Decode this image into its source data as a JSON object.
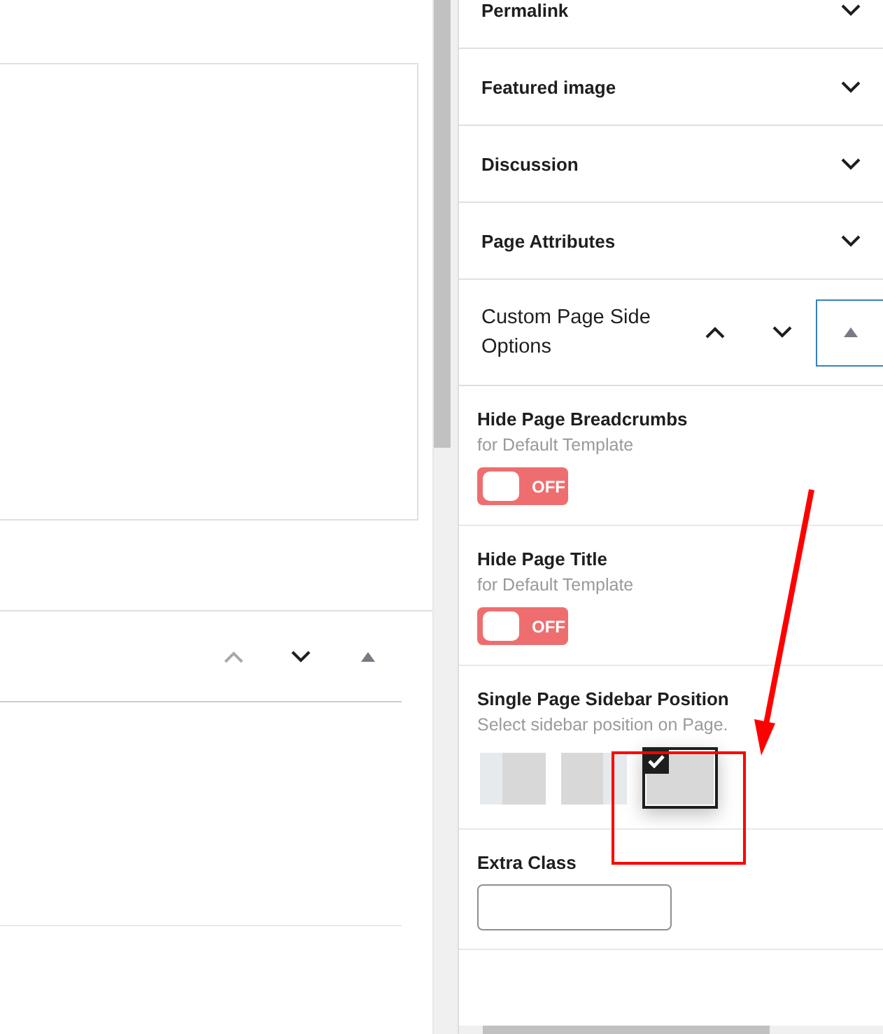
{
  "editor_panel": {
    "controls": [
      {
        "kind": "up",
        "disabled": true
      },
      {
        "kind": "down",
        "disabled": false
      },
      {
        "kind": "toggle",
        "focused": false
      }
    ]
  },
  "sidebar": {
    "panels": [
      {
        "title": "Permalink",
        "expanded": false
      },
      {
        "title": "Featured image",
        "expanded": false
      },
      {
        "title": "Discussion",
        "expanded": false
      },
      {
        "title": "Page Attributes",
        "expanded": false
      }
    ],
    "custom_panel": {
      "title": "Custom Page Side Options",
      "controls": [
        {
          "kind": "up",
          "disabled": false
        },
        {
          "kind": "down",
          "disabled": false
        },
        {
          "kind": "toggle",
          "focused": true
        }
      ],
      "fields": [
        {
          "kind": "switch",
          "label": "Hide Page Breadcrumbs",
          "hint": "for Default Template",
          "on": false,
          "state_text": "OFF"
        },
        {
          "kind": "switch",
          "label": "Hide Page Title",
          "hint": "for Default Template",
          "on": false,
          "state_text": "OFF"
        },
        {
          "kind": "layout",
          "label": "Single Page Sidebar Position",
          "hint": "Select sidebar position on Page.",
          "options": [
            {
              "kind": "left",
              "selected": false
            },
            {
              "kind": "right",
              "selected": false
            },
            {
              "kind": "full",
              "selected": true
            }
          ]
        },
        {
          "kind": "text",
          "label": "Extra Class"
        }
      ]
    }
  }
}
